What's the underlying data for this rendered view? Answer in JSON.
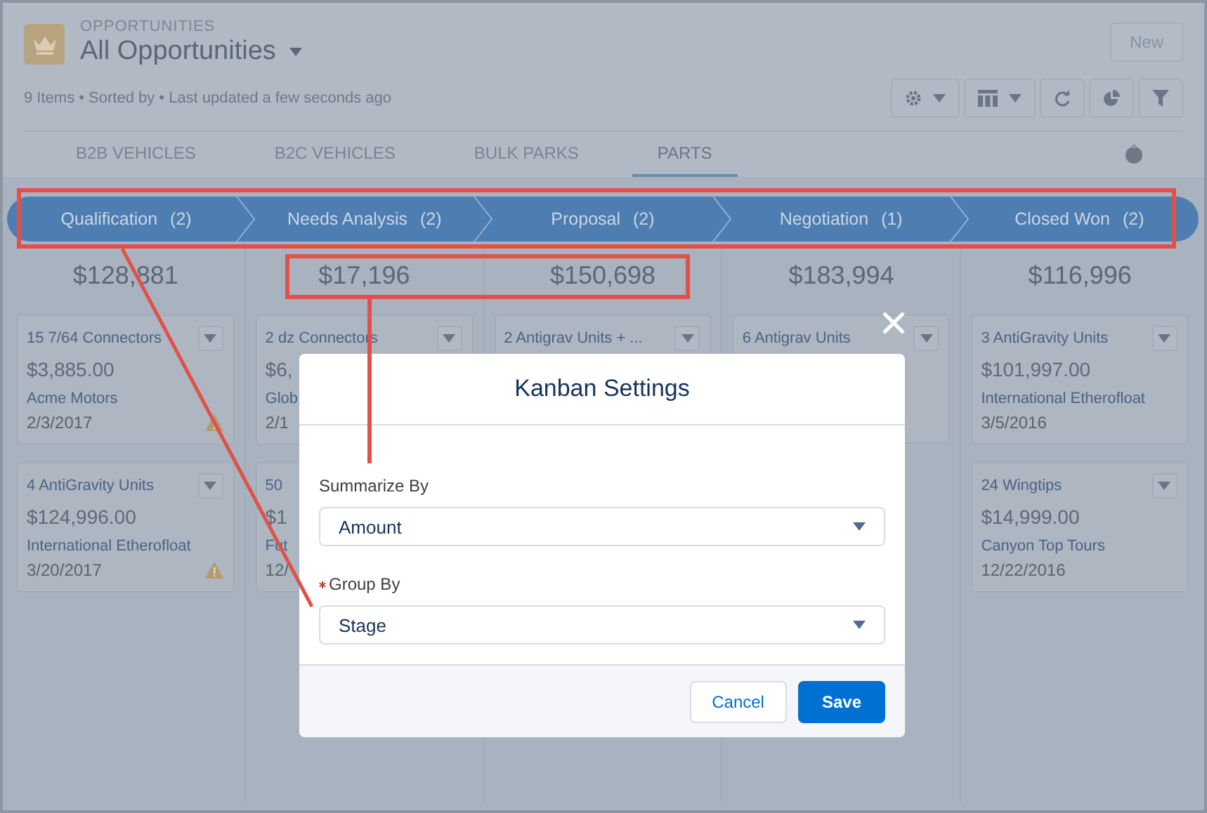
{
  "header": {
    "object_label": "OPPORTUNITIES",
    "list_title": "All Opportunities",
    "new_button": "New",
    "meta": "9 Items • Sorted by • Last updated a few seconds ago"
  },
  "tabs": [
    {
      "label": "B2B VEHICLES",
      "selected": false
    },
    {
      "label": "B2C VEHICLES",
      "selected": false
    },
    {
      "label": "BULK PARKS",
      "selected": false
    },
    {
      "label": "PARTS",
      "selected": true
    }
  ],
  "path": [
    {
      "label": "Qualification",
      "count": "(2)"
    },
    {
      "label": "Needs Analysis",
      "count": "(2)"
    },
    {
      "label": "Proposal",
      "count": "(2)"
    },
    {
      "label": "Negotiation",
      "count": "(1)"
    },
    {
      "label": "Closed Won",
      "count": "(2)"
    }
  ],
  "columns": [
    {
      "total": "$128,881",
      "cards": [
        {
          "title": "15 7/64 Connectors",
          "amount": "$3,885.00",
          "account": "Acme Motors",
          "date": "2/3/2017",
          "warning": true
        },
        {
          "title": "4 AntiGravity Units",
          "amount": "$124,996.00",
          "account": "International Etherofloat",
          "date": "3/20/2017",
          "warning": true
        }
      ]
    },
    {
      "total": "$17,196",
      "cards": [
        {
          "title": "2 dz Connectors",
          "amount": "$6,",
          "account": "Glob",
          "date": "2/1"
        },
        {
          "title": "50",
          "amount": "$1",
          "account": "Fut",
          "date": "12/"
        }
      ]
    },
    {
      "total": "$150,698",
      "cards": [
        {
          "title": "2 Antigrav Units + ..."
        }
      ]
    },
    {
      "total": "$183,994",
      "cards": [
        {
          "title": "6 Antigrav Units"
        }
      ]
    },
    {
      "total": "$116,996",
      "cards": [
        {
          "title": "3 AntiGravity Units",
          "amount": "$101,997.00",
          "account": "International Etherofloat",
          "date": "3/5/2016",
          "warning": false
        },
        {
          "title": "24 Wingtips",
          "amount": "$14,999.00",
          "account": "Canyon Top Tours",
          "date": "12/22/2016",
          "warning": false
        }
      ]
    }
  ],
  "modal": {
    "title": "Kanban Settings",
    "fields": [
      {
        "label": "Summarize By",
        "value": "Amount",
        "required": false
      },
      {
        "label": "Group By",
        "value": "Stage",
        "required": true
      }
    ],
    "buttons": [
      {
        "label": "Cancel",
        "kind": "neutral"
      },
      {
        "label": "Save",
        "kind": "brand"
      }
    ]
  }
}
